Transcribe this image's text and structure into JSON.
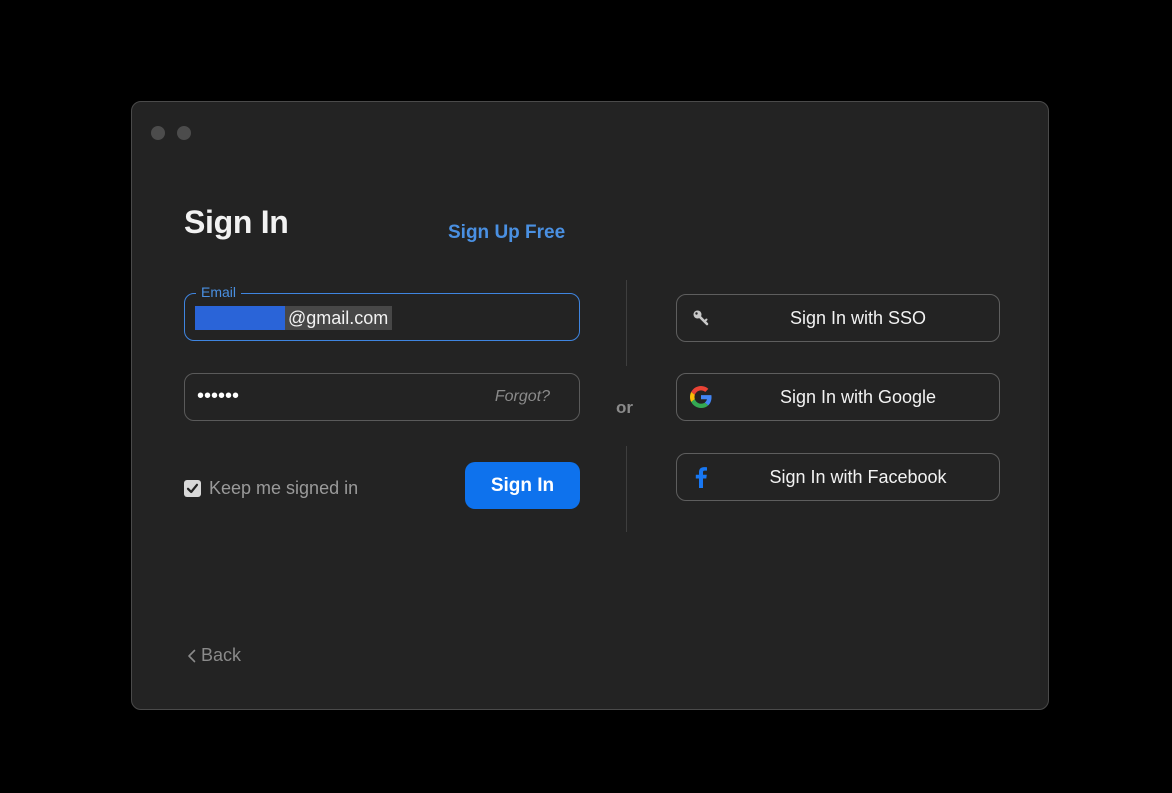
{
  "window": {
    "title": "Sign In",
    "signup_link": "Sign Up Free"
  },
  "form": {
    "email_label": "Email",
    "email_value_visible": "@gmail.com",
    "password_mask": "••••••",
    "forgot_label": "Forgot?",
    "keep_signed_in_label": "Keep me signed in",
    "keep_signed_in_checked": true,
    "signin_button": "Sign In"
  },
  "divider": {
    "or_label": "or"
  },
  "sso": {
    "buttons": [
      {
        "label": "Sign In with SSO",
        "icon": "key-icon"
      },
      {
        "label": "Sign In with Google",
        "icon": "google-icon"
      },
      {
        "label": "Sign In with Facebook",
        "icon": "facebook-icon"
      }
    ]
  },
  "footer": {
    "back_label": "Back"
  },
  "colors": {
    "accent": "#0e72ed",
    "link": "#4a90e2",
    "window_bg": "#232323",
    "redaction": "#2a64d8"
  }
}
